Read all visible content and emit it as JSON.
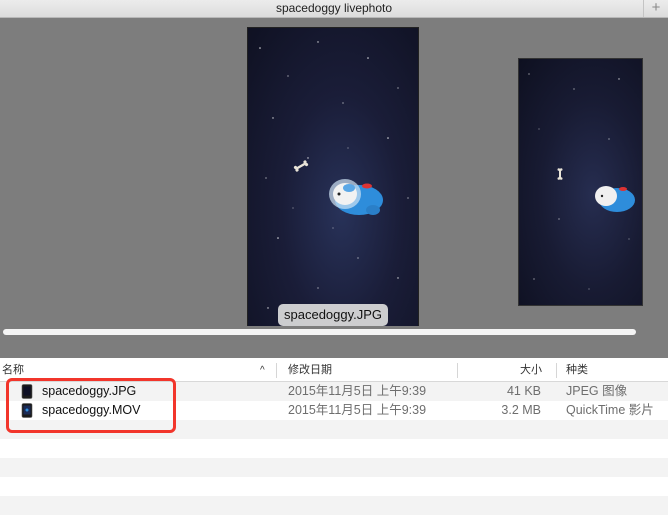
{
  "window": {
    "title": "spacedoggy livephoto"
  },
  "preview": {
    "caption": "spacedoggy.JPG"
  },
  "columns": {
    "name": "名称",
    "modified": "修改日期",
    "size": "大小",
    "kind": "种类"
  },
  "files": [
    {
      "name": "spacedoggy.JPG",
      "modified": "2015年11月5日 上午9:39",
      "size": "41 KB",
      "kind": "JPEG 图像",
      "icon": "jpg-file-icon"
    },
    {
      "name": "spacedoggy.MOV",
      "modified": "2015年11月5日 上午9:39",
      "size": "3.2 MB",
      "kind": "QuickTime 影片",
      "icon": "mov-file-icon"
    }
  ],
  "colors": {
    "highlight": "#f2352b",
    "coverflow_bg": "#7d7d7d"
  }
}
